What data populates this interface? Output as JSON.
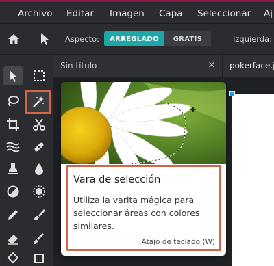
{
  "menu": [
    "Archivo",
    "Editar",
    "Imagen",
    "Capa",
    "Seleccionar",
    "Aj"
  ],
  "options": {
    "aspect_label": "Aspecto:",
    "aspect_on": "ARREGLADO",
    "aspect_off": "GRATIS",
    "left_label": "Izquierda:"
  },
  "tabs": [
    {
      "title": "Sin título",
      "close": "×"
    },
    {
      "title": "pokerface.j"
    }
  ],
  "tooltip": {
    "title": "Vara de selección",
    "description": "Utiliza la varita mágica para seleccionar áreas con colores similares.",
    "shortcut": "Atajo de teclado (W)"
  },
  "colors": {
    "accent": "#1fa7a8",
    "highlight": "#d5634a",
    "topstrip": "#8c1a4b",
    "handle": "#19a3e0"
  }
}
